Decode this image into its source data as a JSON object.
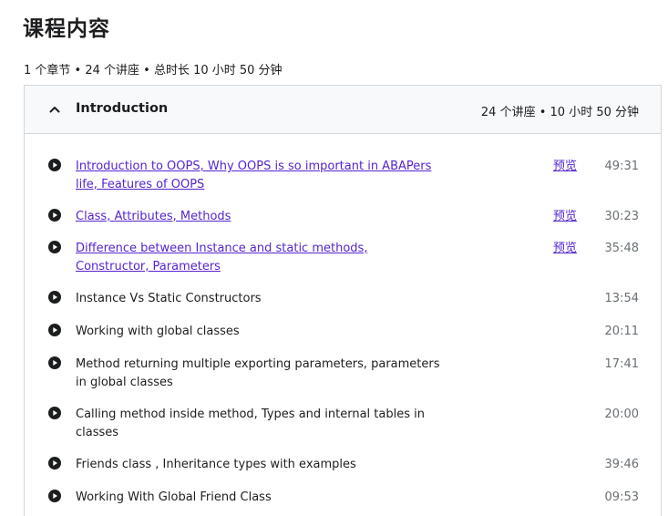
{
  "page": {
    "title": "课程内容",
    "summary": "1 个章节 • 24 个讲座 • 总时长 10 小时 50 分钟"
  },
  "section": {
    "title": "Introduction",
    "meta": "24 个讲座 • 10 小时 50 分钟",
    "icon": "chevron-up-icon"
  },
  "colors": {
    "link": "#5624d0",
    "text": "#1c1d1f",
    "muted": "#6a6f73",
    "header_bg": "#f7f9fa",
    "border": "#d1d7dc"
  },
  "lectures": [
    {
      "title": "Introduction to OOPS, Why OOPS is so important in ABAPers life, Features of OOPS",
      "preview": "预览",
      "duration": "49:31"
    },
    {
      "title": "Class, Attributes, Methods",
      "preview": "预览",
      "duration": "30:23"
    },
    {
      "title": "Difference between Instance and static methods, Constructor, Parameters",
      "preview": "预览",
      "duration": "35:48"
    },
    {
      "title": "Instance Vs Static Constructors",
      "preview": "",
      "duration": "13:54"
    },
    {
      "title": "Working with global classes",
      "preview": "",
      "duration": "20:11"
    },
    {
      "title": "Method returning multiple exporting parameters, parameters in global classes",
      "preview": "",
      "duration": "17:41"
    },
    {
      "title": "Calling method inside method, Types and internal tables in classes",
      "preview": "",
      "duration": "20:00"
    },
    {
      "title": "Friends class , Inheritance types with examples",
      "preview": "",
      "duration": "39:46"
    },
    {
      "title": "Working With Global Friend Class",
      "preview": "",
      "duration": "09:53"
    }
  ]
}
